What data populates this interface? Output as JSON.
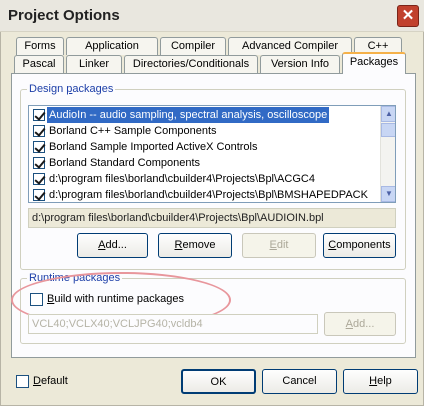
{
  "window": {
    "title": "Project Options",
    "close_glyph": "✕"
  },
  "tabs_row1": [
    "Forms",
    "Application",
    "Compiler",
    "Advanced Compiler",
    "C++"
  ],
  "tabs_row2": [
    "Pascal",
    "Linker",
    "Directories/Conditionals",
    "Version Info",
    "Packages"
  ],
  "active_tab": "Packages",
  "design_packages": {
    "legend_pre": "Design ",
    "legend_underlined": "p",
    "legend_post": "ackages",
    "items": [
      {
        "label": "AudioIn -- audio sampling, spectral analysis, oscilloscope",
        "checked": true,
        "selected": true
      },
      {
        "label": "Borland C++ Sample Components",
        "checked": true,
        "selected": false
      },
      {
        "label": "Borland Sample Imported ActiveX Controls",
        "checked": true,
        "selected": false
      },
      {
        "label": "Borland Standard Components",
        "checked": true,
        "selected": false
      },
      {
        "label": "d:\\program files\\borland\\cbuilder4\\Projects\\Bpl\\ACGC4",
        "checked": true,
        "selected": false
      },
      {
        "label": "d:\\program files\\borland\\cbuilder4\\Projects\\Bpl\\BMSHAPEDPACK",
        "checked": true,
        "selected": false
      }
    ],
    "path": "d:\\program files\\borland\\cbuilder4\\Projects\\Bpl\\AUDIOIN.bpl",
    "buttons": {
      "add": {
        "u": "A",
        "rest": "dd..."
      },
      "remove": {
        "u": "R",
        "rest": "emove"
      },
      "edit": {
        "u": "E",
        "rest": "dit"
      },
      "components": {
        "u": "C",
        "rest": "omponents"
      }
    }
  },
  "runtime_packages": {
    "legend": "Runtime packages",
    "build_checkbox": {
      "u": "B",
      "rest": "uild with runtime packages",
      "checked": false
    },
    "packages_value": "VCL40;VCLX40;VCLJPG40;vcldb4",
    "add_button": {
      "u": "A",
      "rest": "dd..."
    }
  },
  "footer": {
    "default_checkbox": {
      "u": "D",
      "rest": "efault",
      "checked": false
    },
    "ok": "OK",
    "cancel": "Cancel",
    "help": {
      "u": "H",
      "rest": "elp"
    }
  }
}
